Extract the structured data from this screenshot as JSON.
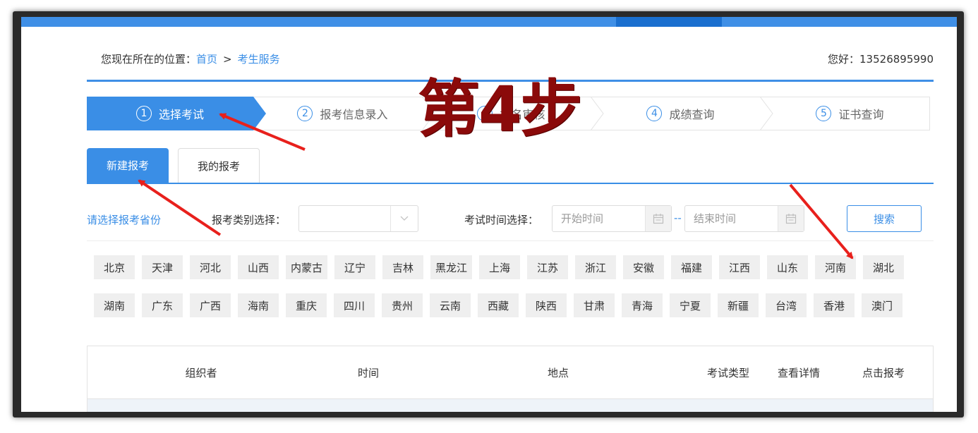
{
  "breadcrumb": {
    "prefix": "您现在所在的位置：",
    "home": "首页",
    "separator": ">",
    "current": "考生服务"
  },
  "greeting": "您好：13526895990",
  "steps": [
    {
      "num": "1",
      "label": "选择考试",
      "active": true
    },
    {
      "num": "2",
      "label": "报考信息录入",
      "active": false
    },
    {
      "num": "3",
      "label": "报名审核",
      "active": false
    },
    {
      "num": "4",
      "label": "成绩查询",
      "active": false
    },
    {
      "num": "5",
      "label": "证书查询",
      "active": false
    }
  ],
  "tabs": {
    "new": "新建报考",
    "mine": "我的报考"
  },
  "filters": {
    "province_hint": "请选择报考省份",
    "type_label": "报考类别选择：",
    "type_value": "",
    "time_label": "考试时间选择：",
    "start_placeholder": "开始时间",
    "range_dash": "--",
    "end_placeholder": "结束时间",
    "search_label": "搜索"
  },
  "provinces_row1": [
    "北京",
    "天津",
    "河北",
    "山西",
    "内蒙古",
    "辽宁",
    "吉林",
    "黑龙江",
    "上海",
    "江苏",
    "浙江",
    "安徽",
    "福建",
    "江西",
    "山东",
    "河南",
    "湖北"
  ],
  "provinces_row2": [
    "湖南",
    "广东",
    "广西",
    "海南",
    "重庆",
    "四川",
    "贵州",
    "云南",
    "西藏",
    "陕西",
    "甘肃",
    "青海",
    "宁夏",
    "新疆",
    "台湾",
    "香港",
    "澳门"
  ],
  "table": {
    "headers": [
      "组织者",
      "时间",
      "地点",
      "考试类型",
      "查看详情",
      "点击报考"
    ]
  },
  "annotation": {
    "title": "第4步",
    "color": "#8b0a0a",
    "arrow_color": "#e8201c"
  },
  "colors": {
    "accent": "#3a8ee6",
    "topbar": "#3f8fe6",
    "tag_bg": "#efefef"
  }
}
